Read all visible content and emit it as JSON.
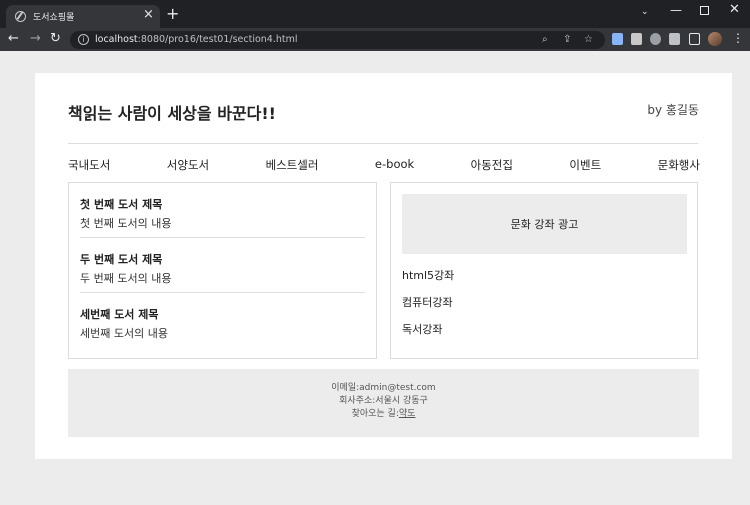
{
  "browser": {
    "tab_title": "도서쇼핑몰",
    "tab_close": "×",
    "new_tab": "+",
    "url_host": "localhost",
    "url_path": ":8080/pro16/test01/section4.html",
    "icons": [
      "globe-icon",
      "back-arrow-icon",
      "forward-arrow-icon",
      "reload-icon",
      "info-icon",
      "zoom-icon",
      "share-icon",
      "star-icon",
      "extension-icon",
      "profile-avatar-icon",
      "menu-dots-icon"
    ]
  },
  "header": {
    "title": "책읽는 사람이 세상을 바꾼다!!",
    "author": "by 홍길동"
  },
  "menu": {
    "items": [
      "국내도서",
      "서양도서",
      "베스트셀러",
      "e-book",
      "아동전집",
      "이벤트",
      "문화행사"
    ]
  },
  "books": [
    {
      "title": "첫 번째 도서 제목",
      "desc": "첫 번째 도서의 내용"
    },
    {
      "title": "두 번째 도서 제목",
      "desc": "두 번째 도서의 내용"
    },
    {
      "title": "세번째 도서 제목",
      "desc": "세번째 도서의 내용"
    }
  ],
  "sidebar": {
    "ad_text": "문화 강좌 광고",
    "courses": [
      "html5강좌",
      "컴퓨터강좌",
      "독서강좌"
    ]
  },
  "footer": {
    "email": "이메일:admin@test.com",
    "address": "회사주소:서울시 강동구",
    "directions_label": "찾아오는 길:",
    "directions_link": "약도"
  },
  "colors": {
    "page_bg": "#ececec",
    "card_bg": "#ffffff",
    "chrome_dark": "#202124",
    "chrome_toolbar": "#35363a"
  }
}
